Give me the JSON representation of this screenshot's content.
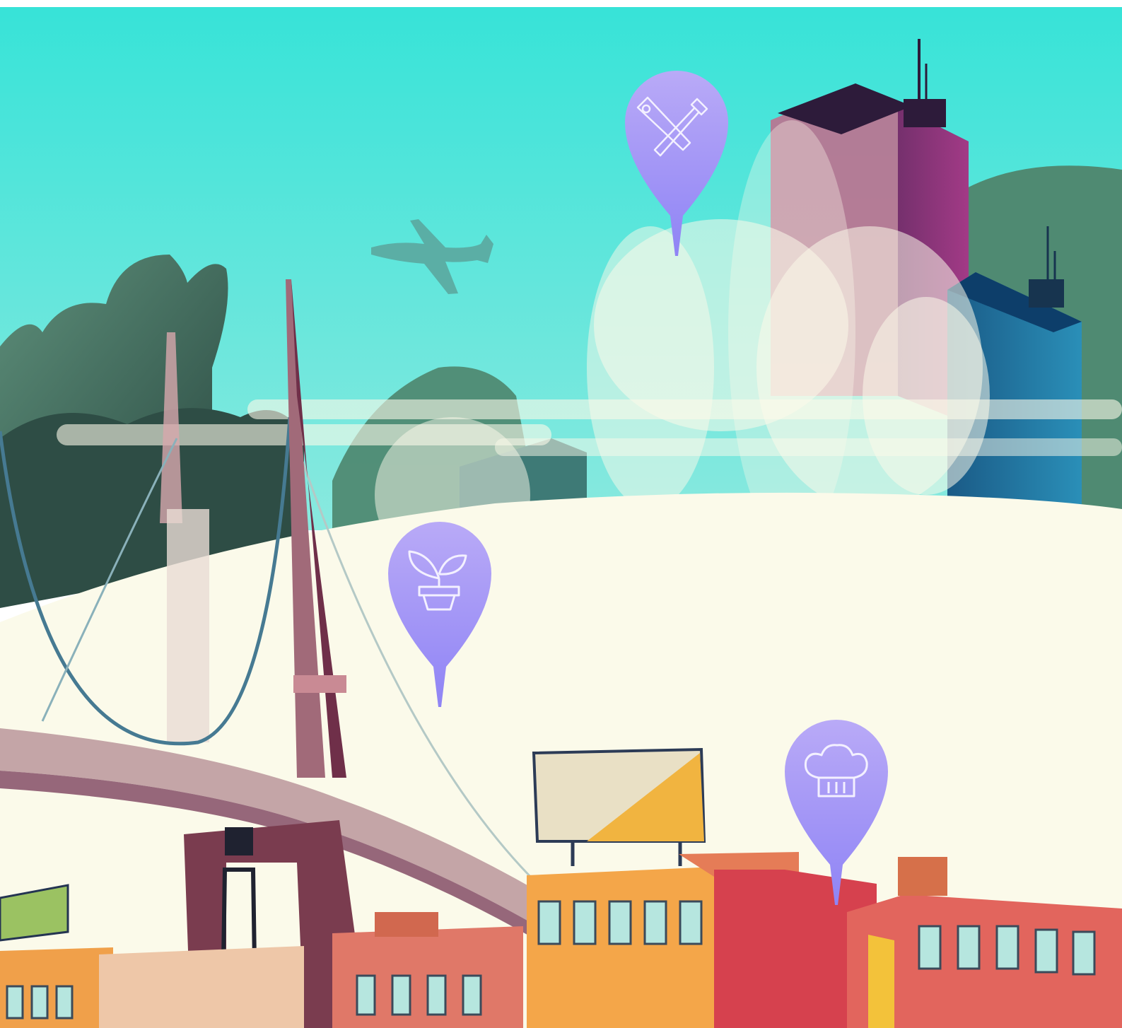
{
  "scene": {
    "colors": {
      "sky_top": "#3ee6d8",
      "sky_bottom": "#7de8e0",
      "fog": "#fbfaea",
      "pin_top": "#b9aaf7",
      "pin_bottom": "#8f84f5",
      "hills_dark": "#3f6a5c",
      "bridge": "#b98a95",
      "bridge_dark": "#7a3c4f",
      "building_orange": "#f2a64a",
      "building_red": "#d8454f",
      "skyscraper_purple": "#8a3a7a",
      "skyscraper_blue": "#1f6d9a"
    }
  },
  "pins": [
    {
      "name": "tools-pin",
      "icon": "saw-hammer-icon"
    },
    {
      "name": "plant-pin",
      "icon": "potted-plant-icon"
    },
    {
      "name": "chef-pin",
      "icon": "chef-hat-icon"
    }
  ]
}
